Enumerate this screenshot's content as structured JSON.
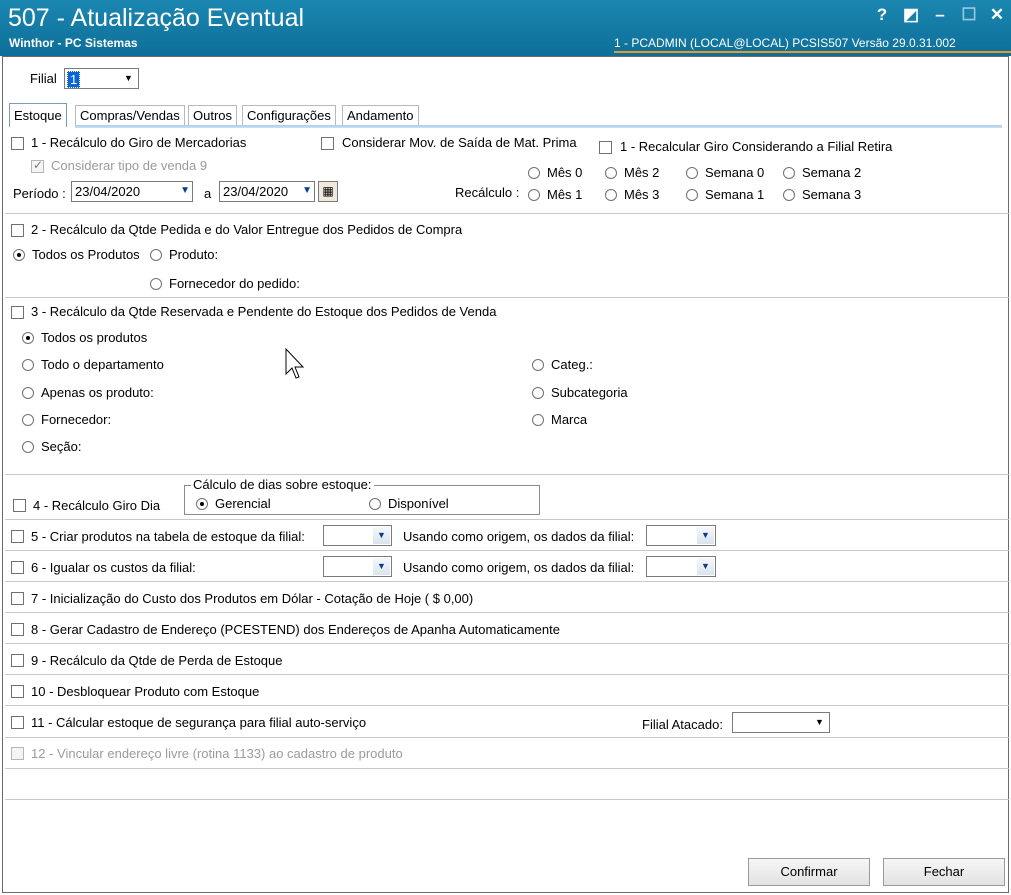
{
  "window": {
    "title": "507 - Atualização Eventual",
    "subtitle": "Winthor - PC Sistemas",
    "status": "1 - PCADMIN (LOCAL@LOCAL)   PCSIS507  Versão  29.0.31.002",
    "help_glyph": "?",
    "restore_glyph": "◩",
    "minimize_glyph": "–",
    "maximize_glyph": "☐",
    "close_glyph": "✕"
  },
  "filial": {
    "label": "Filial",
    "value": "1"
  },
  "tabs": [
    {
      "label": "Estoque"
    },
    {
      "label": "Compras/Vendas"
    },
    {
      "label": "Outros"
    },
    {
      "label": "Configurações"
    },
    {
      "label": "Andamento"
    }
  ],
  "section1": {
    "label": "1 - Recálculo do Giro de Mercadorias",
    "mov_saida_label": "Considerar Mov. de Saída de Mat. Prima",
    "filial_retira_label": "1 - Recalcular Giro Considerando a Filial Retira",
    "tipo_venda_label": "Considerar tipo de venda 9",
    "periodo_label": "Período :",
    "date_from": "23/04/2020",
    "date_sep": "a",
    "date_to": "23/04/2020",
    "recalculo_label": "Recálculo :",
    "options_row1": [
      "Mês 0",
      "Mês 2",
      "Semana 0",
      "Semana 2"
    ],
    "options_row2": [
      "Mês 1",
      "Mês 3",
      "Semana 1",
      "Semana 3"
    ]
  },
  "section2": {
    "label": "2 - Recálculo da Qtde Pedida e do Valor Entregue dos Pedidos de Compra",
    "todos": "Todos os Produtos",
    "produto": "Produto:",
    "fornecedor": "Fornecedor do pedido:"
  },
  "section3": {
    "label": "3 - Recálculo da Qtde Reservada e Pendente do Estoque dos Pedidos de Venda",
    "todos": "Todos os produtos",
    "departamento": "Todo o departamento",
    "apenas": "Apenas os produto:",
    "fornecedor": "Fornecedor:",
    "secao": "Seção:",
    "categ": "Categ.:",
    "subcategoria": "Subcategoria",
    "marca": "Marca"
  },
  "section4": {
    "label": "4 - Recálculo Giro Dia",
    "group_title": "Cálculo de dias sobre estoque:",
    "gerencial": "Gerencial",
    "disponivel": "Disponível"
  },
  "section5": {
    "label": "5 - Criar produtos na tabela de estoque da filial:",
    "origem": "Usando como origem, os dados da filial:"
  },
  "section6": {
    "label": "6 - Igualar os custos da filial:",
    "origem": "Usando como origem, os dados da filial:"
  },
  "section7": {
    "label": "7 - Inicialização do Custo dos Produtos em Dólar - Cotação de Hoje ( $ 0,00)"
  },
  "section8": {
    "label": "8 - Gerar Cadastro de Endereço (PCESTEND) dos Endereços de Apanha Automaticamente"
  },
  "section9": {
    "label": "9 - Recálculo da Qtde de Perda de Estoque"
  },
  "section10": {
    "label": "10 - Desbloquear Produto com Estoque"
  },
  "section11": {
    "label": "11 - Cálcular estoque de segurança para filial auto-serviço",
    "atacado_label": "Filial Atacado:"
  },
  "section12": {
    "label": "12 - Vincular endereço livre (rotina 1133) ao cadastro de produto"
  },
  "buttons": {
    "confirmar": "Confirmar",
    "fechar": "Fechar"
  },
  "colors": {
    "titlebar": "#1b87b1",
    "status_underline": "#e69a2b",
    "tab_line": "#aecbe8"
  }
}
